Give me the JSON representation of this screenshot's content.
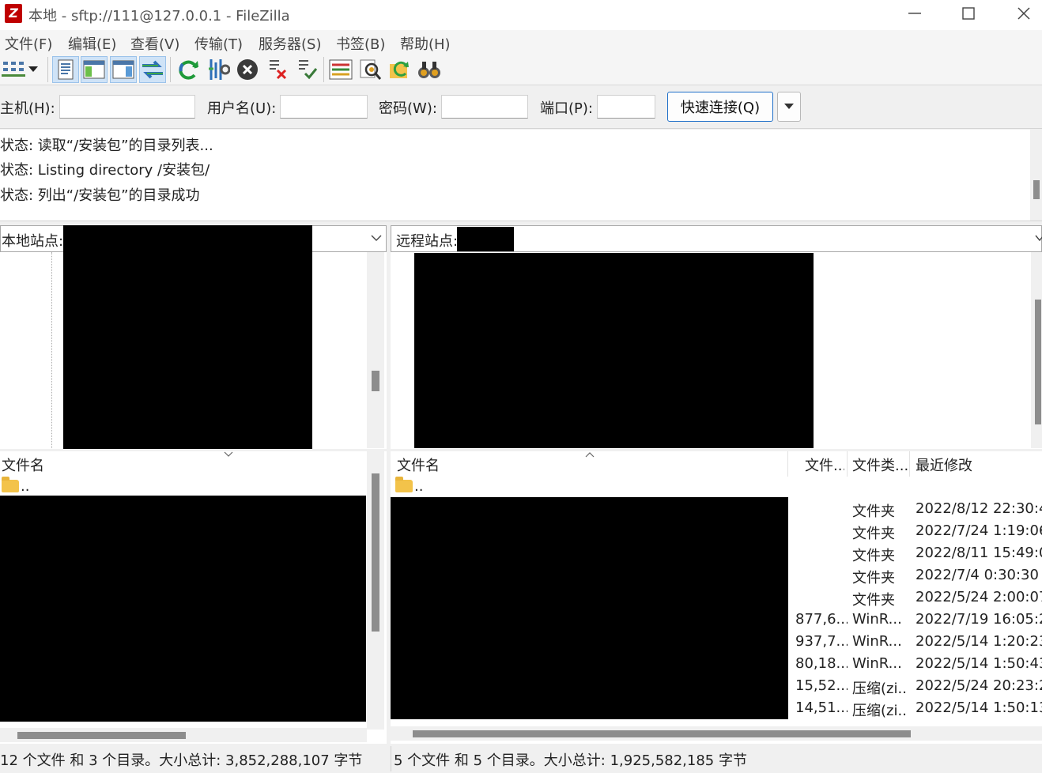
{
  "window": {
    "title": "本地 - sftp://111@127.0.0.1 - FileZilla",
    "app_icon_letter": "Z"
  },
  "menu": [
    "文件(F)",
    "编辑(E)",
    "查看(V)",
    "传输(T)",
    "服务器(S)",
    "书签(B)",
    "帮助(H)"
  ],
  "toolbar": {
    "icons": [
      "site-manager-icon",
      "dropdown-arrow-icon",
      "toggle-log-icon",
      "toggle-local-tree-icon",
      "toggle-remote-tree-icon",
      "toggle-queue-icon",
      "refresh-icon",
      "process-queue-icon",
      "cancel-icon",
      "disconnect-icon",
      "reconnect-icon",
      "directory-compare-icon",
      "filter-icon",
      "sync-browse-icon",
      "search-icon"
    ]
  },
  "quickconnect": {
    "host_label": "主机(H):",
    "user_label": "用户名(U):",
    "pass_label": "密码(W):",
    "port_label": "端口(P):",
    "host_value": "",
    "user_value": "",
    "pass_value": "",
    "port_value": "",
    "connect_label": "快速连接(Q)"
  },
  "log": [
    "状态: 读取“/安装包”的目录列表...",
    "状态: Listing directory /安装包/",
    "状态: 列出“/安装包”的目录成功"
  ],
  "local": {
    "site_label": "本地站点:",
    "header_name": "文件名",
    "parent_entry": "..",
    "status": "12 个文件 和 3 个目录。大小总计: 3,852,288,107 字节"
  },
  "remote": {
    "site_label": "远程站点:",
    "headers": {
      "name": "文件名",
      "size": "文件...",
      "type": "文件类...",
      "modified": "最近修改"
    },
    "parent_entry": "..",
    "rows": [
      {
        "size": "",
        "type": "文件夹",
        "modified": "2022/8/12 22:30:4"
      },
      {
        "size": "",
        "type": "文件夹",
        "modified": "2022/7/24 1:19:06"
      },
      {
        "size": "",
        "type": "文件夹",
        "modified": "2022/8/11 15:49:0"
      },
      {
        "size": "",
        "type": "文件夹",
        "modified": "2022/7/4 0:30:30"
      },
      {
        "size": "",
        "type": "文件夹",
        "modified": "2022/5/24 2:00:07"
      },
      {
        "size": "877,6...",
        "type": "WinR...",
        "modified": "2022/7/19 16:05:2"
      },
      {
        "size": "937,7...",
        "type": "WinR...",
        "modified": "2022/5/14 1:20:23"
      },
      {
        "size": "80,18...",
        "type": "WinR...",
        "modified": "2022/5/14 1:50:43"
      },
      {
        "size": "15,52...",
        "type": "压缩(zi...",
        "modified": "2022/5/24 20:23:2"
      },
      {
        "size": "14,51...",
        "type": "压缩(zi...",
        "modified": "2022/5/14 1:50:13"
      }
    ],
    "status": "5 个文件 和 5 个目录。大小总计: 1,925,582,185 字节"
  },
  "colors": {
    "accent": "#1e6fc9",
    "redaction": "#000000",
    "logo": "#bf0000"
  }
}
